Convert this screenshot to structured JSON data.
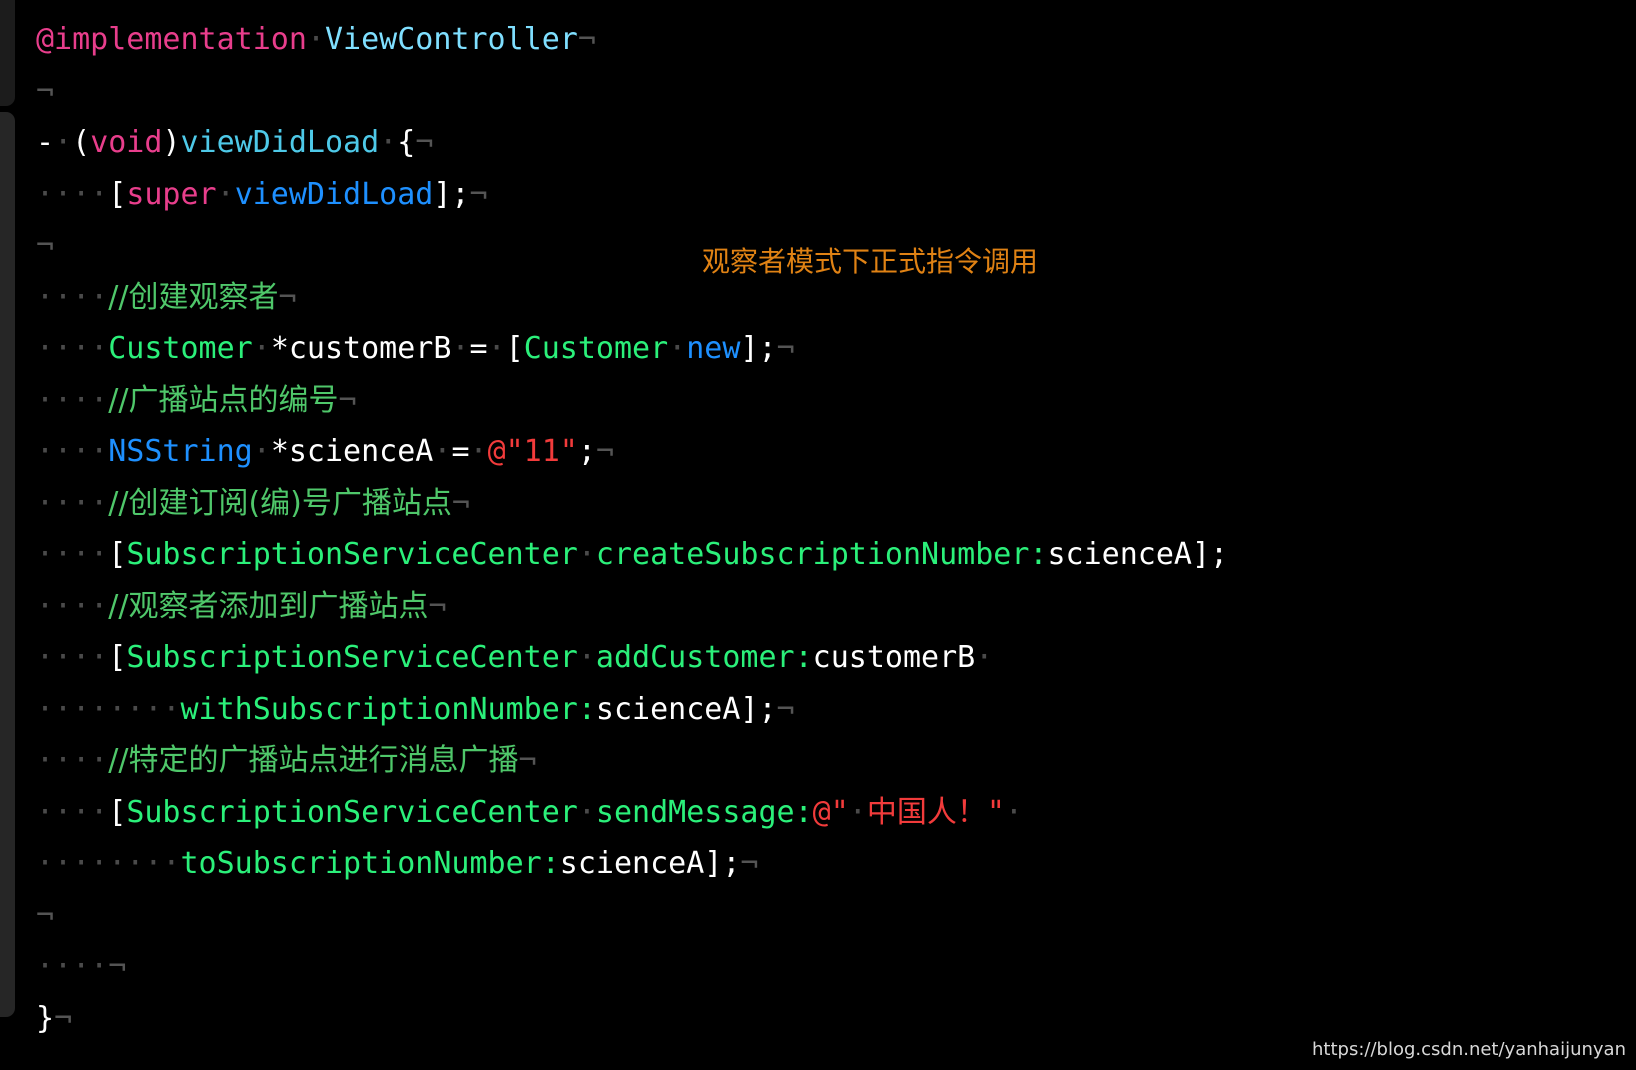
{
  "window": {
    "background": "#000000",
    "kind": "code-editor-screenshot",
    "language": "Objective-C"
  },
  "palette": {
    "plain": "#ffffff",
    "keyword": "#e83e8c",
    "type": "#7fdfff",
    "selector": "#4ec9e8",
    "class": "#2bf07a",
    "blue": "#1e90ff",
    "string": "#f23b3b",
    "comment": "#4fc76a",
    "invisible": "#545454",
    "dot": "#4a4a4a",
    "annotation": "#e08214",
    "watermark": "#d8d8d8"
  },
  "glyphs": {
    "line_end": "¬",
    "space_dot": "·"
  },
  "annotation": {
    "text": "观察者模式下正式指令调用"
  },
  "watermark": {
    "text": "https://blog.csdn.net/yanhaijunyan"
  },
  "code": {
    "lines": [
      {
        "id": "line-1",
        "tokens": [
          {
            "c": "key",
            "t": "@implementation"
          },
          {
            "c": "dot",
            "t": "·"
          },
          {
            "c": "type",
            "t": "ViewController"
          },
          {
            "c": "invisible",
            "t": "¬"
          }
        ]
      },
      {
        "id": "line-2",
        "tokens": [
          {
            "c": "invisible",
            "t": "¬"
          }
        ]
      },
      {
        "id": "line-3",
        "tokens": [
          {
            "c": "plain",
            "t": "-"
          },
          {
            "c": "dot",
            "t": "·"
          },
          {
            "c": "plain",
            "t": "("
          },
          {
            "c": "key",
            "t": "void"
          },
          {
            "c": "plain",
            "t": ")"
          },
          {
            "c": "selector",
            "t": "viewDidLoad"
          },
          {
            "c": "dot",
            "t": "·"
          },
          {
            "c": "plain",
            "t": "{"
          },
          {
            "c": "invisible",
            "t": "¬"
          }
        ]
      },
      {
        "id": "line-4",
        "tokens": [
          {
            "c": "dot",
            "t": "····"
          },
          {
            "c": "plain",
            "t": "["
          },
          {
            "c": "key",
            "t": "super"
          },
          {
            "c": "dot",
            "t": "·"
          },
          {
            "c": "blue",
            "t": "viewDidLoad"
          },
          {
            "c": "plain",
            "t": "];"
          },
          {
            "c": "invisible",
            "t": "¬"
          }
        ]
      },
      {
        "id": "line-5",
        "tokens": [
          {
            "c": "invisible",
            "t": "¬"
          }
        ]
      },
      {
        "id": "line-6",
        "tokens": [
          {
            "c": "dot",
            "t": "····"
          },
          {
            "c": "comment",
            "t": "//创建观察者"
          },
          {
            "c": "invisible",
            "t": "¬"
          }
        ]
      },
      {
        "id": "line-7",
        "tokens": [
          {
            "c": "dot",
            "t": "····"
          },
          {
            "c": "class",
            "t": "Customer"
          },
          {
            "c": "dot",
            "t": "·"
          },
          {
            "c": "plain",
            "t": "*customerB"
          },
          {
            "c": "dot",
            "t": "·"
          },
          {
            "c": "plain",
            "t": "="
          },
          {
            "c": "dot",
            "t": "·"
          },
          {
            "c": "plain",
            "t": "["
          },
          {
            "c": "class",
            "t": "Customer"
          },
          {
            "c": "dot",
            "t": "·"
          },
          {
            "c": "blue",
            "t": "new"
          },
          {
            "c": "plain",
            "t": "];"
          },
          {
            "c": "invisible",
            "t": "¬"
          }
        ]
      },
      {
        "id": "line-8",
        "tokens": [
          {
            "c": "dot",
            "t": "····"
          },
          {
            "c": "comment",
            "t": "//广播站点的编号"
          },
          {
            "c": "invisible",
            "t": "¬"
          }
        ]
      },
      {
        "id": "line-9",
        "tokens": [
          {
            "c": "dot",
            "t": "····"
          },
          {
            "c": "blue",
            "t": "NSString"
          },
          {
            "c": "dot",
            "t": "·"
          },
          {
            "c": "plain",
            "t": "*scienceA"
          },
          {
            "c": "dot",
            "t": "·"
          },
          {
            "c": "plain",
            "t": "="
          },
          {
            "c": "dot",
            "t": "·"
          },
          {
            "c": "string",
            "t": "@\"11\""
          },
          {
            "c": "plain",
            "t": ";"
          },
          {
            "c": "invisible",
            "t": "¬"
          }
        ]
      },
      {
        "id": "line-10",
        "tokens": [
          {
            "c": "dot",
            "t": "····"
          },
          {
            "c": "comment",
            "t": "//创建订阅(编)号广播站点"
          },
          {
            "c": "invisible",
            "t": "¬"
          }
        ]
      },
      {
        "id": "line-11",
        "tokens": [
          {
            "c": "dot",
            "t": "····"
          },
          {
            "c": "plain",
            "t": "["
          },
          {
            "c": "class",
            "t": "SubscriptionServiceCenter"
          },
          {
            "c": "dot",
            "t": "·"
          },
          {
            "c": "class",
            "t": "createSubscriptionNumber:"
          },
          {
            "c": "plain",
            "t": "scienceA];"
          }
        ]
      },
      {
        "id": "line-12",
        "tokens": [
          {
            "c": "dot",
            "t": "····"
          },
          {
            "c": "comment",
            "t": "//观察者添加到广播站点"
          },
          {
            "c": "invisible",
            "t": "¬"
          }
        ]
      },
      {
        "id": "line-13",
        "tokens": [
          {
            "c": "dot",
            "t": "····"
          },
          {
            "c": "plain",
            "t": "["
          },
          {
            "c": "class",
            "t": "SubscriptionServiceCenter"
          },
          {
            "c": "dot",
            "t": "·"
          },
          {
            "c": "class",
            "t": "addCustomer:"
          },
          {
            "c": "plain",
            "t": "customerB"
          },
          {
            "c": "dot",
            "t": "·"
          }
        ]
      },
      {
        "id": "line-14",
        "tokens": [
          {
            "c": "dot",
            "t": "········"
          },
          {
            "c": "class",
            "t": "withSubscriptionNumber:"
          },
          {
            "c": "plain",
            "t": "scienceA];"
          },
          {
            "c": "invisible",
            "t": "¬"
          }
        ]
      },
      {
        "id": "line-15",
        "tokens": [
          {
            "c": "dot",
            "t": "····"
          },
          {
            "c": "comment",
            "t": "//特定的广播站点进行消息广播"
          },
          {
            "c": "invisible",
            "t": "¬"
          }
        ]
      },
      {
        "id": "line-16",
        "tokens": [
          {
            "c": "dot",
            "t": "····"
          },
          {
            "c": "plain",
            "t": "["
          },
          {
            "c": "class",
            "t": "SubscriptionServiceCenter"
          },
          {
            "c": "dot",
            "t": "·"
          },
          {
            "c": "class",
            "t": "sendMessage:"
          },
          {
            "c": "string",
            "t": "@\""
          },
          {
            "c": "dot",
            "t": "·"
          },
          {
            "c": "string",
            "t": "中国人！"
          },
          {
            "c": "string",
            "t": "\""
          },
          {
            "c": "dot",
            "t": "·"
          }
        ]
      },
      {
        "id": "line-17",
        "tokens": [
          {
            "c": "dot",
            "t": "········"
          },
          {
            "c": "class",
            "t": "toSubscriptionNumber:"
          },
          {
            "c": "plain",
            "t": "scienceA];"
          },
          {
            "c": "invisible",
            "t": "¬"
          }
        ]
      },
      {
        "id": "line-18",
        "tokens": [
          {
            "c": "invisible",
            "t": "¬"
          }
        ]
      },
      {
        "id": "line-19",
        "tokens": [
          {
            "c": "dot",
            "t": "····"
          },
          {
            "c": "invisible",
            "t": "¬"
          }
        ]
      },
      {
        "id": "line-20",
        "tokens": [
          {
            "c": "plain",
            "t": "}"
          },
          {
            "c": "invisible",
            "t": "¬"
          }
        ]
      }
    ]
  }
}
